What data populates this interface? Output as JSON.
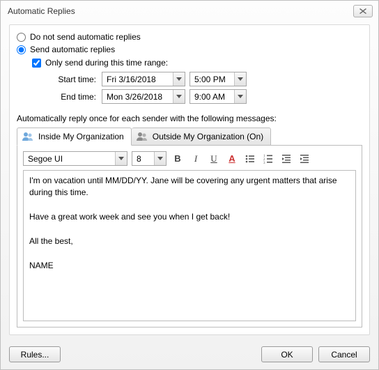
{
  "title": "Automatic Replies",
  "radios": {
    "dont_send": "Do not send automatic replies",
    "send": "Send automatic replies",
    "selected": "send"
  },
  "time_range": {
    "checkbox_label": "Only send during this time range:",
    "checked": true,
    "start_label": "Start time:",
    "start_date": "Fri 3/16/2018",
    "start_time": "5:00 PM",
    "end_label": "End time:",
    "end_date": "Mon 3/26/2018",
    "end_time": "9:00 AM"
  },
  "section_label": "Automatically reply once for each sender with the following messages:",
  "tabs": {
    "inside": "Inside My Organization",
    "outside": "Outside My Organization (On)",
    "active": "inside"
  },
  "editor": {
    "font": "Segoe UI",
    "size": "8",
    "body": "I'm on vacation until MM/DD/YY. Jane will be covering any urgent matters that arise during this time.\n\nHave a great work week and see you when I get back!\n\nAll the best,\n\nNAME"
  },
  "buttons": {
    "rules": "Rules...",
    "ok": "OK",
    "cancel": "Cancel"
  }
}
